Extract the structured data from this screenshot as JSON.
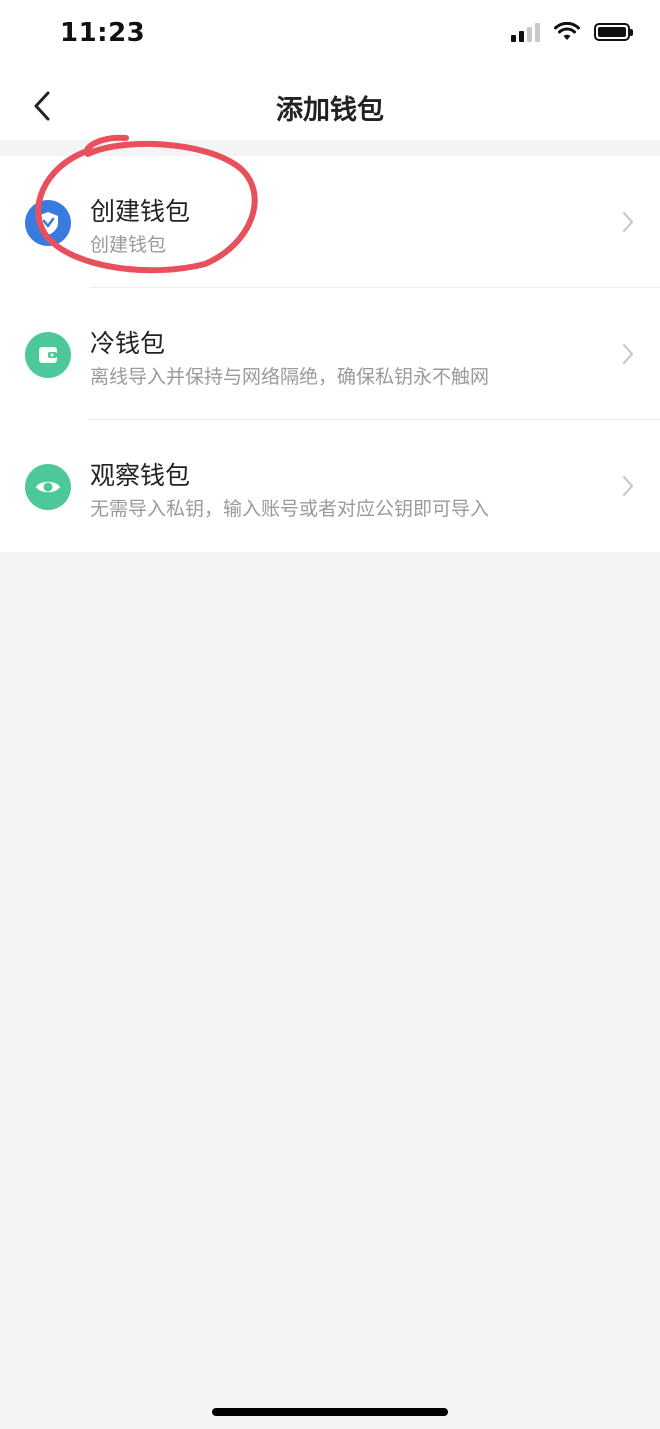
{
  "status_bar": {
    "time": "11:23"
  },
  "header": {
    "title": "添加钱包",
    "back_icon": "chevron-left-icon"
  },
  "options": [
    {
      "title": "创建钱包",
      "subtitle": "创建钱包",
      "icon": "wallet-shield-icon",
      "icon_color": "#3a7be0"
    },
    {
      "title": "冷钱包",
      "subtitle": "离线导入并保持与网络隔绝，确保私钥永不触网",
      "icon": "cold-wallet-icon",
      "icon_color": "#4cc89a"
    },
    {
      "title": "观察钱包",
      "subtitle": "无需导入私钥，输入账号或者对应公钥即可导入",
      "icon": "eye-icon",
      "icon_color": "#4cc89a"
    }
  ],
  "annotation_color": "#e8505b"
}
